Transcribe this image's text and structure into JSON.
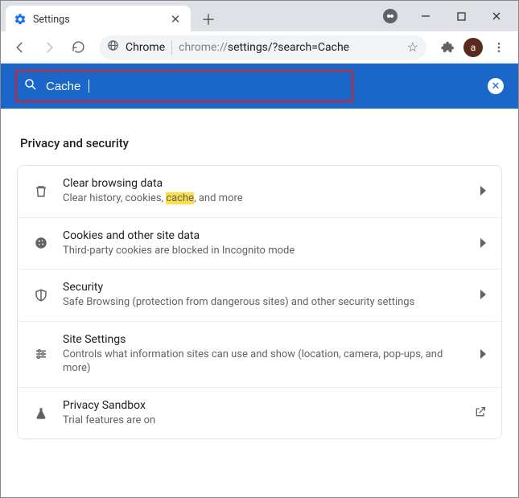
{
  "window": {
    "tab_title": "Settings",
    "incognito": true
  },
  "toolbar": {
    "url_prefix": "Chrome",
    "url_scheme": "chrome://",
    "url_path": "settings/?search=Cache",
    "avatar_letter": "a"
  },
  "search": {
    "value": "Cache"
  },
  "section": {
    "title": "Privacy and security"
  },
  "rows": [
    {
      "icon": "trash-icon",
      "title": "Clear browsing data",
      "sub_pre": "Clear history, cookies, ",
      "sub_hl": "cache",
      "sub_post": ", and more",
      "action": "chevron"
    },
    {
      "icon": "cookie-icon",
      "title": "Cookies and other site data",
      "sub": "Third-party cookies are blocked in Incognito mode",
      "action": "chevron"
    },
    {
      "icon": "shield-icon",
      "title": "Security",
      "sub": "Safe Browsing (protection from dangerous sites) and other security settings",
      "action": "chevron"
    },
    {
      "icon": "sliders-icon",
      "title": "Site Settings",
      "sub": "Controls what information sites can use and show (location, camera, pop-ups, and more)",
      "action": "chevron"
    },
    {
      "icon": "flask-icon",
      "title": "Privacy Sandbox",
      "sub": "Trial features are on",
      "action": "external"
    }
  ]
}
